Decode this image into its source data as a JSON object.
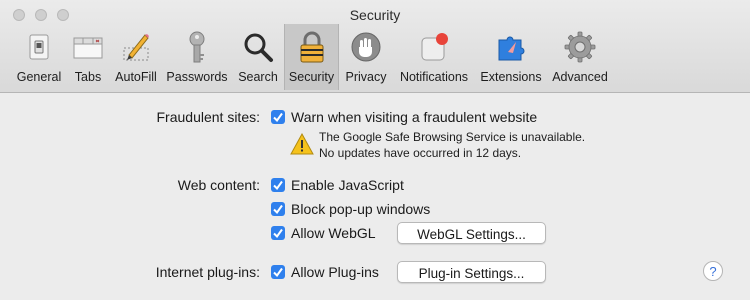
{
  "window": {
    "title": "Security"
  },
  "toolbar": {
    "items": [
      {
        "label": "General",
        "icon": "switch-icon"
      },
      {
        "label": "Tabs",
        "icon": "tabs-icon"
      },
      {
        "label": "AutoFill",
        "icon": "pencil-icon"
      },
      {
        "label": "Passwords",
        "icon": "key-icon"
      },
      {
        "label": "Search",
        "icon": "magnifier-icon"
      },
      {
        "label": "Security",
        "icon": "padlock-icon",
        "selected": true
      },
      {
        "label": "Privacy",
        "icon": "hand-icon"
      },
      {
        "label": "Notifications",
        "icon": "notification-badge-icon"
      },
      {
        "label": "Extensions",
        "icon": "puzzle-compass-icon"
      },
      {
        "label": "Advanced",
        "icon": "gear-icon"
      }
    ]
  },
  "fraud": {
    "label": "Fraudulent sites:",
    "option": "Warn when visiting a fraudulent website",
    "checked": true,
    "warning_line1": "The Google Safe Browsing Service is unavailable.",
    "warning_line2": "No updates have occurred in 12 days."
  },
  "web": {
    "label": "Web content:",
    "js": "Enable JavaScript",
    "popups": "Block pop-up windows",
    "webgl": "Allow WebGL",
    "webgl_button": "WebGL Settings..."
  },
  "plugins": {
    "label": "Internet plug-ins:",
    "allow": "Allow Plug-ins",
    "button": "Plug-in Settings..."
  },
  "help": {
    "glyph": "?"
  },
  "colors": {
    "checkbox": "#2f80ed",
    "background": "#ececec",
    "selected_tab": "#c8c8c8"
  }
}
